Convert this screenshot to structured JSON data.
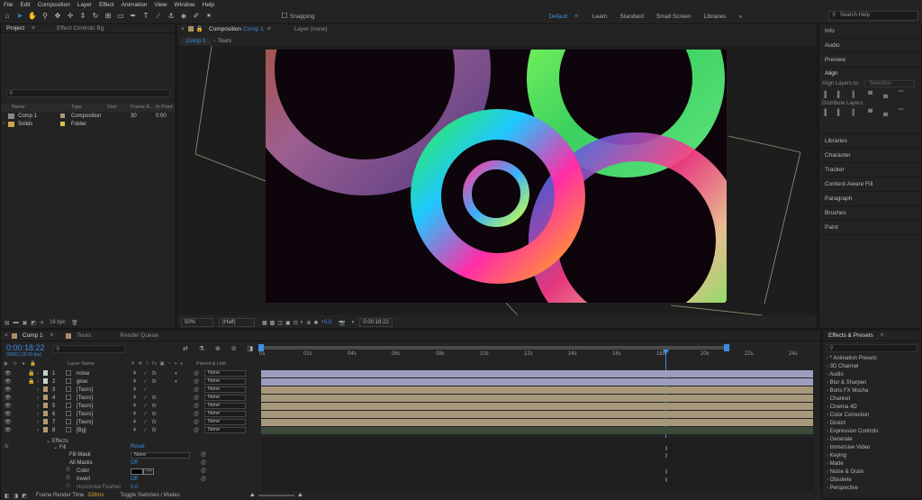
{
  "menu": [
    "File",
    "Edit",
    "Composition",
    "Layer",
    "Effect",
    "Animation",
    "View",
    "Window",
    "Help"
  ],
  "toolbar": {
    "snapping_label": "Snapping",
    "workspaces": [
      "Default",
      "Learn",
      "Standard",
      "Small Screen",
      "Libraries"
    ],
    "active_workspace": "Default",
    "more_label": "»",
    "search_placeholder": "Search Help"
  },
  "project": {
    "tab_label": "Project",
    "effect_controls_label": "Effect Controls Bg",
    "columns": [
      "Name",
      "Type",
      "Size",
      "Frame R...",
      "In Point"
    ],
    "items": [
      {
        "name": "Comp 1",
        "type": "Composition",
        "frame_rate": "30",
        "in_point": "0:00"
      },
      {
        "name": "Solids",
        "type": "Folder",
        "frame_rate": "",
        "in_point": ""
      }
    ],
    "bpc": "16 bpc"
  },
  "composition": {
    "tab_label": "Composition",
    "tab_name": "Comp 1",
    "layer_tab": "Layer (none)",
    "breadcrumb": [
      "Comp 1",
      "Tours"
    ],
    "zoom": "50%",
    "resolution": "(Half)",
    "exposure": "+0.0",
    "timecode": "0:00:18:22"
  },
  "right_panels": {
    "top": [
      "Info",
      "Audio",
      "Preview"
    ],
    "align_title": "Align",
    "align_to_label": "Align Layers to:",
    "align_to_value": "Selection",
    "distribute_label": "Distribute Layers:",
    "bottom": [
      "Libraries",
      "Character",
      "Tracker",
      "Content-Aware Fill",
      "Paragraph",
      "Brushes",
      "Paint"
    ]
  },
  "effects_presets": {
    "title": "Effects & Presets",
    "items": [
      "* Animation Presets",
      "3D Channel",
      "Audio",
      "Blur & Sharpen",
      "Boris FX Mocha",
      "Channel",
      "Cinema 4D",
      "Color Correction",
      "Distort",
      "Expression Controls",
      "Generate",
      "Immersive Video",
      "Keying",
      "Matte",
      "Noise & Grain",
      "Obsolete",
      "Perspective"
    ]
  },
  "timeline": {
    "tabs": [
      "Comp 1",
      "Tours",
      "Render Queue"
    ],
    "timecode": "0:00:18:22",
    "fps": "00562 (30.00 fps)",
    "col_layer_name": "Layer Name",
    "col_parent": "Parent & Link",
    "ruler": [
      "0s",
      "02s",
      "04s",
      "06s",
      "08s",
      "10s",
      "12s",
      "14s",
      "16s",
      "18s",
      "20s",
      "22s",
      "24s"
    ],
    "layers": [
      {
        "num": "1",
        "name": "noise",
        "color": "#cfcfcf",
        "parent": "None"
      },
      {
        "num": "2",
        "name": "glow",
        "color": "#cfcfcf",
        "parent": "None"
      },
      {
        "num": "3",
        "name": "[Tours]",
        "color": "#b59a6e",
        "parent": "None"
      },
      {
        "num": "4",
        "name": "[Tours]",
        "color": "#b59a6e",
        "parent": "None"
      },
      {
        "num": "5",
        "name": "[Tours]",
        "color": "#b59a6e",
        "parent": "None"
      },
      {
        "num": "6",
        "name": "[Tours]",
        "color": "#b59a6e",
        "parent": "None"
      },
      {
        "num": "7",
        "name": "[Tours]",
        "color": "#b59a6e",
        "parent": "None"
      },
      {
        "num": "8",
        "name": "[Bg]",
        "color": "#b59a6e",
        "parent": "None"
      }
    ],
    "effects_label": "Effects",
    "fill_label": "Fill",
    "reset_label": "Reset",
    "props": [
      {
        "name": "Fill Mask",
        "value": "None"
      },
      {
        "name": "All Masks",
        "value": "Off"
      },
      {
        "name": "Color",
        "value": ""
      },
      {
        "name": "Invert",
        "value": "Off"
      },
      {
        "name": "Horizontal Feather",
        "value": "0.0"
      }
    ],
    "render_time_label": "Frame Render Time",
    "render_time": "328ms",
    "toggle_label": "Toggle Switches / Modes"
  }
}
